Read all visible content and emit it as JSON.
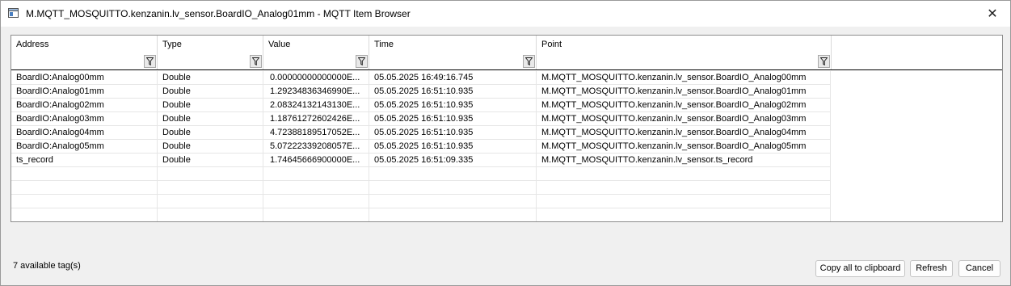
{
  "window": {
    "title": "M.MQTT_MOSQUITTO.kenzanin.lv_sensor.BoardIO_Analog01mm - MQTT Item Browser",
    "close_glyph": "✕"
  },
  "table": {
    "columns": [
      "Address",
      "Type",
      "Value",
      "Time",
      "Point"
    ],
    "rows": [
      [
        "BoardIO:Analog00mm",
        "Double",
        "0.00000000000000E...",
        "05.05.2025 16:49:16.745",
        "M.MQTT_MOSQUITTO.kenzanin.lv_sensor.BoardIO_Analog00mm"
      ],
      [
        "BoardIO:Analog01mm",
        "Double",
        "1.29234836346990E...",
        "05.05.2025 16:51:10.935",
        "M.MQTT_MOSQUITTO.kenzanin.lv_sensor.BoardIO_Analog01mm"
      ],
      [
        "BoardIO:Analog02mm",
        "Double",
        "2.08324132143130E...",
        "05.05.2025 16:51:10.935",
        "M.MQTT_MOSQUITTO.kenzanin.lv_sensor.BoardIO_Analog02mm"
      ],
      [
        "BoardIO:Analog03mm",
        "Double",
        "1.18761272602426E...",
        "05.05.2025 16:51:10.935",
        "M.MQTT_MOSQUITTO.kenzanin.lv_sensor.BoardIO_Analog03mm"
      ],
      [
        "BoardIO:Analog04mm",
        "Double",
        "4.72388189517052E...",
        "05.05.2025 16:51:10.935",
        "M.MQTT_MOSQUITTO.kenzanin.lv_sensor.BoardIO_Analog04mm"
      ],
      [
        "BoardIO:Analog05mm",
        "Double",
        "5.07222339208057E...",
        "05.05.2025 16:51:10.935",
        "M.MQTT_MOSQUITTO.kenzanin.lv_sensor.BoardIO_Analog05mm"
      ],
      [
        "ts_record",
        "Double",
        "1.74645666900000E...",
        "05.05.2025 16:51:09.335",
        "M.MQTT_MOSQUITTO.kenzanin.lv_sensor.ts_record"
      ]
    ]
  },
  "status": {
    "count_text": "7 available tag(s)"
  },
  "buttons": {
    "copy": "Copy all to clipboard",
    "refresh": "Refresh",
    "cancel": "Cancel"
  }
}
